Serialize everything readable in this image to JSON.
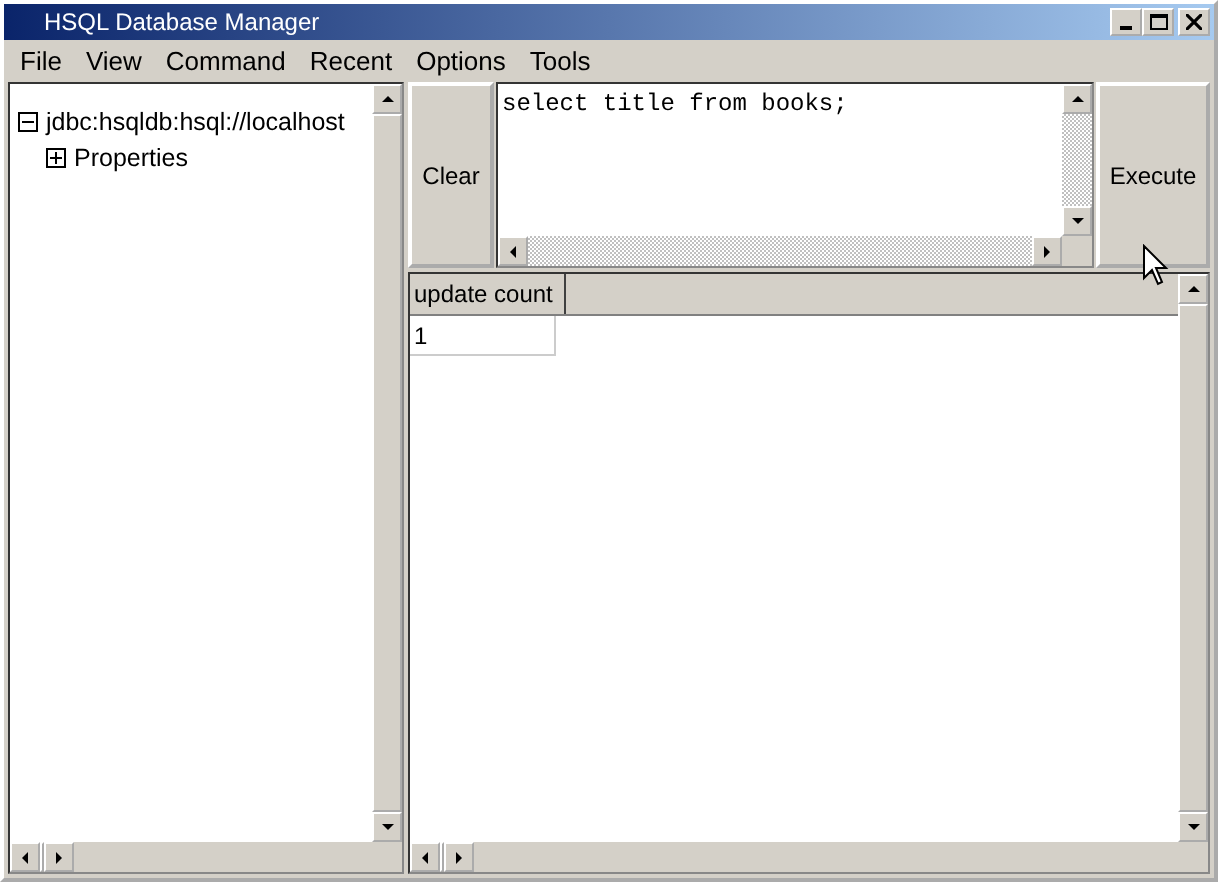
{
  "window": {
    "title": "HSQL Database Manager"
  },
  "menu": [
    "File",
    "View",
    "Command",
    "Recent",
    "Options",
    "Tools"
  ],
  "tree": {
    "label": "jdbc:hsqldb:hsql://localhost",
    "expanded": true,
    "children": [
      {
        "label": "Properties",
        "expanded": false
      }
    ]
  },
  "buttons": {
    "clear": "Clear",
    "execute": "Execute"
  },
  "query": {
    "value": "select title from books;"
  },
  "results": {
    "columns": [
      "update count"
    ],
    "rows": [
      [
        "1"
      ]
    ]
  }
}
